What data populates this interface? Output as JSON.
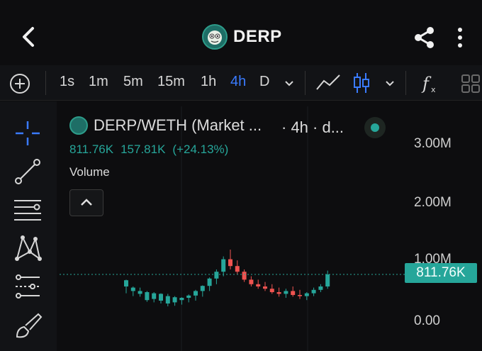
{
  "header": {
    "title": "DERP",
    "back_icon": "chevron-left-icon",
    "share_icon": "share-icon",
    "more_icon": "more-vertical-icon"
  },
  "toolbar": {
    "intervals": [
      "1s",
      "1m",
      "5m",
      "15m",
      "1h",
      "4h",
      "D"
    ],
    "active_interval": "4h"
  },
  "chart": {
    "pair": "DERP/WETH (Market ...",
    "interval_suffix": "· 4h · d...",
    "last_value": "811.76K",
    "change_abs": "157.81K",
    "change_pct": "(+24.13%)",
    "volume_label": "Volume",
    "price_tag": "811.76K",
    "up_color": "#26a69a",
    "down_color": "#ef5350"
  },
  "chart_data": {
    "type": "candlestick",
    "y_ticks": [
      "3.00M",
      "2.00M",
      "1.00M",
      "0.00"
    ],
    "ylim": [
      0,
      3600000
    ],
    "last_price": 811760,
    "candles": [
      [
        720000,
        480000,
        600000,
        710000
      ],
      [
        600000,
        430000,
        520000,
        580000
      ],
      [
        580000,
        420000,
        470000,
        520000
      ],
      [
        520000,
        330000,
        360000,
        500000
      ],
      [
        500000,
        320000,
        380000,
        480000
      ],
      [
        480000,
        300000,
        350000,
        470000
      ],
      [
        470000,
        250000,
        300000,
        430000
      ],
      [
        430000,
        260000,
        320000,
        410000
      ],
      [
        410000,
        280000,
        360000,
        400000
      ],
      [
        460000,
        320000,
        400000,
        440000
      ],
      [
        540000,
        350000,
        440000,
        520000
      ],
      [
        620000,
        420000,
        520000,
        610000
      ],
      [
        760000,
        520000,
        610000,
        740000
      ],
      [
        900000,
        640000,
        740000,
        860000
      ],
      [
        1130000,
        780000,
        860000,
        1080000
      ],
      [
        1250000,
        900000,
        1080000,
        960000
      ],
      [
        1060000,
        820000,
        960000,
        860000
      ],
      [
        900000,
        680000,
        860000,
        720000
      ],
      [
        780000,
        600000,
        720000,
        640000
      ],
      [
        720000,
        560000,
        640000,
        600000
      ],
      [
        680000,
        520000,
        600000,
        560000
      ],
      [
        640000,
        470000,
        560000,
        500000
      ],
      [
        580000,
        420000,
        500000,
        470000
      ],
      [
        560000,
        400000,
        470000,
        520000
      ],
      [
        600000,
        420000,
        520000,
        450000
      ],
      [
        540000,
        380000,
        450000,
        430000
      ],
      [
        500000,
        360000,
        430000,
        480000
      ],
      [
        580000,
        430000,
        480000,
        540000
      ],
      [
        640000,
        500000,
        540000,
        600000
      ],
      [
        880000,
        560000,
        600000,
        811760
      ]
    ]
  },
  "sidebar_tools": [
    "crosshair-icon",
    "trend-line-icon",
    "horizontal-lines-icon",
    "pattern-icon",
    "measure-icon",
    "brush-icon"
  ]
}
